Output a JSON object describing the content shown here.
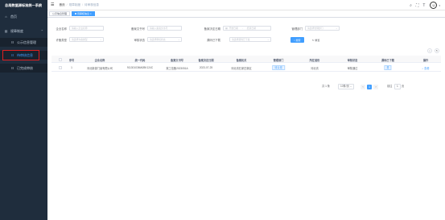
{
  "app": {
    "title": "总局数据源标准统一系统"
  },
  "sidebar": {
    "items": [
      {
        "label": "首页",
        "icon": "home-icon"
      },
      {
        "label": "规章制度",
        "icon": "document-icon"
      },
      {
        "label": "公示信息管理",
        "icon": "list-icon"
      },
      {
        "label": "待审核信息",
        "icon": "list-icon"
      },
      {
        "label": "已完成审核",
        "icon": "list-icon"
      }
    ]
  },
  "breadcrumb": [
    "首页",
    "规章制度",
    "待审核信息"
  ],
  "tabs": [
    "公示信息管理",
    "待审核信息"
  ],
  "filters": {
    "company_name": {
      "label": "企业名称",
      "placeholder": "请输入企业名称"
    },
    "doc_no": {
      "label": "备案文书号",
      "placeholder": "请输入备案文书号"
    },
    "decision_date": {
      "label": "备案决定日期",
      "start": "开始日期",
      "end": "结束日期"
    },
    "gov_agency": {
      "label": "管理部门",
      "placeholder": "请选择管理部门"
    },
    "record_type": {
      "label": "许备类型",
      "placeholder": "请选择许备类型"
    },
    "review_status": {
      "label": "审核状态",
      "placeholder": "请选择审核状态"
    },
    "download_date": {
      "label": "源码已下载",
      "placeholder": "请选择源码已下载"
    },
    "search_label": "搜索",
    "reset_label": "重置"
  },
  "table": {
    "headers": [
      "序号",
      "企业名称",
      "统一代码",
      "备案文书号",
      "备案决定日期",
      "备案机关",
      "管理部门",
      "所在省份",
      "审核状态",
      "源码已下载",
      "操作"
    ],
    "rows": [
      {
        "index": "1",
        "company": "河北新源门窗有限公司",
        "code": "91130103MA0BK124C",
        "doc_no": "冀工信备2023051A",
        "date": "2023-07-25",
        "authority": "河北省石家庄新区",
        "agency": "待认领",
        "province": "河北省",
        "status": "审核通过",
        "download": "是",
        "action": "查看"
      }
    ]
  },
  "pagination": {
    "total": "共 1 条",
    "page_size": "10条/页",
    "prev": "‹",
    "current": "1",
    "next": "›",
    "goto_label": "前往",
    "goto_value": "1",
    "page_unit": "页"
  },
  "colors": {
    "sidebar_bg": "#1f2d3d",
    "accent": "#409eff",
    "highlight": "#e02020"
  }
}
